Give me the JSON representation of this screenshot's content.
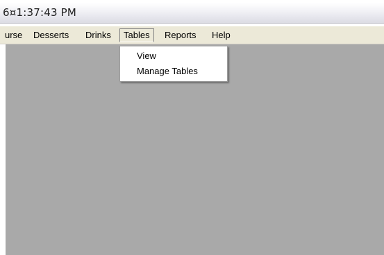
{
  "window": {
    "title": "6¤1:37:43 PM"
  },
  "menu_bar": {
    "items": [
      {
        "label": "urse"
      },
      {
        "label": "Desserts"
      },
      {
        "label": "Drinks"
      },
      {
        "label": "Tables",
        "open": true
      },
      {
        "label": "Reports"
      },
      {
        "label": "Help"
      }
    ]
  },
  "tables_menu": {
    "items": [
      {
        "label": "View"
      },
      {
        "label": "Manage Tables"
      }
    ]
  },
  "colors": {
    "workspace": "#a9a9a9",
    "menu_bar": "#ece9d8",
    "dropdown": "#ffffff"
  }
}
